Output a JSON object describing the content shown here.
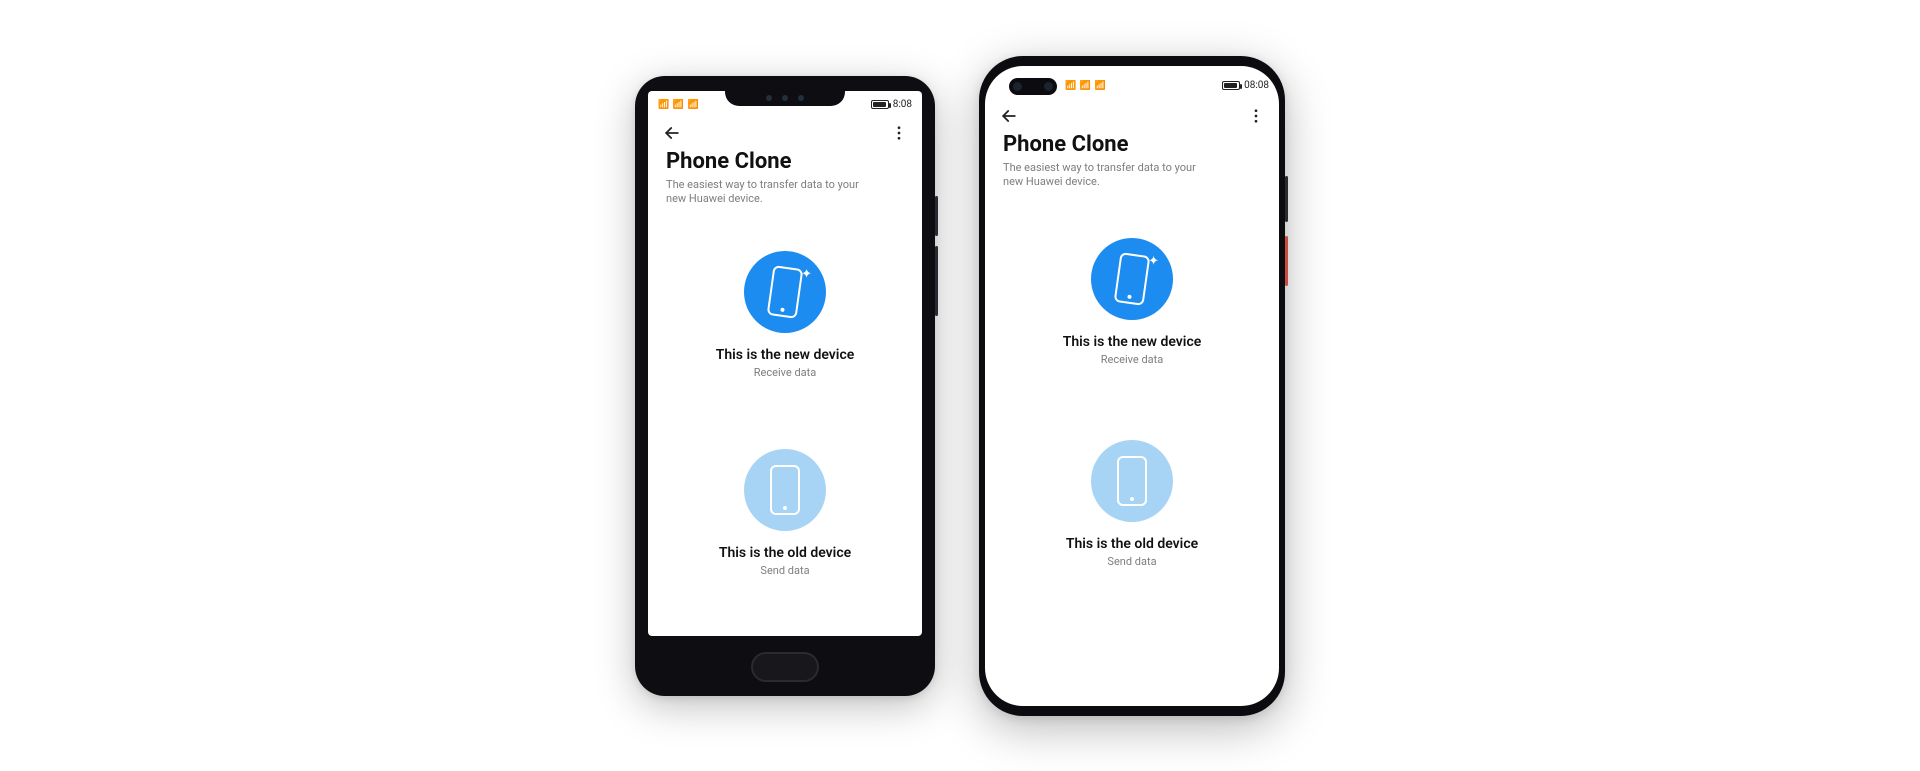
{
  "status": {
    "signal_text": "⁴⁶ ⁴⁶",
    "time": "8:08",
    "time_b": "08:08"
  },
  "app": {
    "title": "Phone Clone",
    "subtitle": "The easiest way to transfer data to your new Huawei device."
  },
  "options": {
    "new": {
      "title": "This is the new device",
      "sub": "Receive data"
    },
    "old": {
      "title": "This is the old device",
      "sub": "Send data"
    }
  }
}
